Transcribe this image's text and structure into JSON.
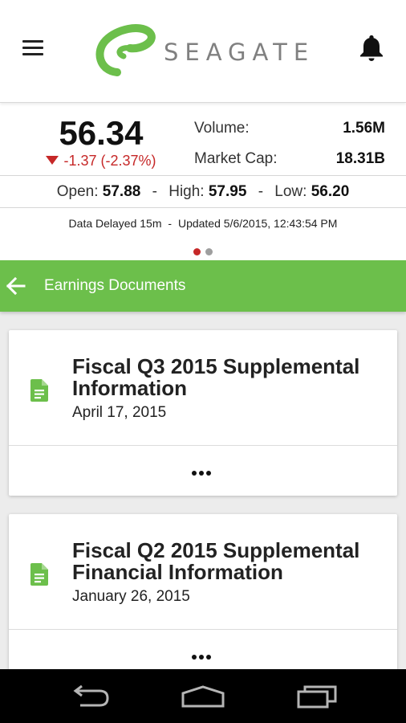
{
  "header": {
    "brand": "SEAGATE",
    "icons": {
      "menu": "hamburger-menu-icon",
      "logo": "seagate-swirl-logo",
      "notifications": "bell-icon"
    },
    "colors": {
      "brand_green": "#6cbf4b",
      "wordmark_gray": "#808080"
    }
  },
  "quote": {
    "price": "56.34",
    "change": "-1.37 (-2.37%)",
    "change_direction": "down",
    "volume_label": "Volume:",
    "volume_value": "1.56M",
    "market_cap_label": "Market Cap:",
    "market_cap_value": "18.31B",
    "open_label": "Open:",
    "open_value": "57.88",
    "high_label": "High:",
    "high_value": "57.95",
    "low_label": "Low:",
    "low_value": "56.20",
    "separator": "-",
    "delay_text": "Data Delayed 15m",
    "updated_text": "Updated 5/6/2015, 12:43:54 PM",
    "delay_sep": "-",
    "pager": {
      "pages": 2,
      "active": 1
    },
    "colors": {
      "negative": "#c62828",
      "dot_active": "#c62828",
      "dot_inactive": "#9e9e9e"
    }
  },
  "section": {
    "title": "Earnings Documents",
    "back_icon": "arrow-left-icon"
  },
  "documents": [
    {
      "title": "Fiscal Q3 2015 Supplemental Information",
      "date": "April 17, 2015",
      "icon": "document-icon",
      "more_icon": "more-horizontal-icon"
    },
    {
      "title": "Fiscal Q2 2015 Supplemental Financial Information",
      "date": "January 26, 2015",
      "icon": "document-icon",
      "more_icon": "more-horizontal-icon"
    }
  ],
  "nav": {
    "back": "nav-back-icon",
    "home": "nav-home-icon",
    "recents": "nav-recents-icon"
  }
}
